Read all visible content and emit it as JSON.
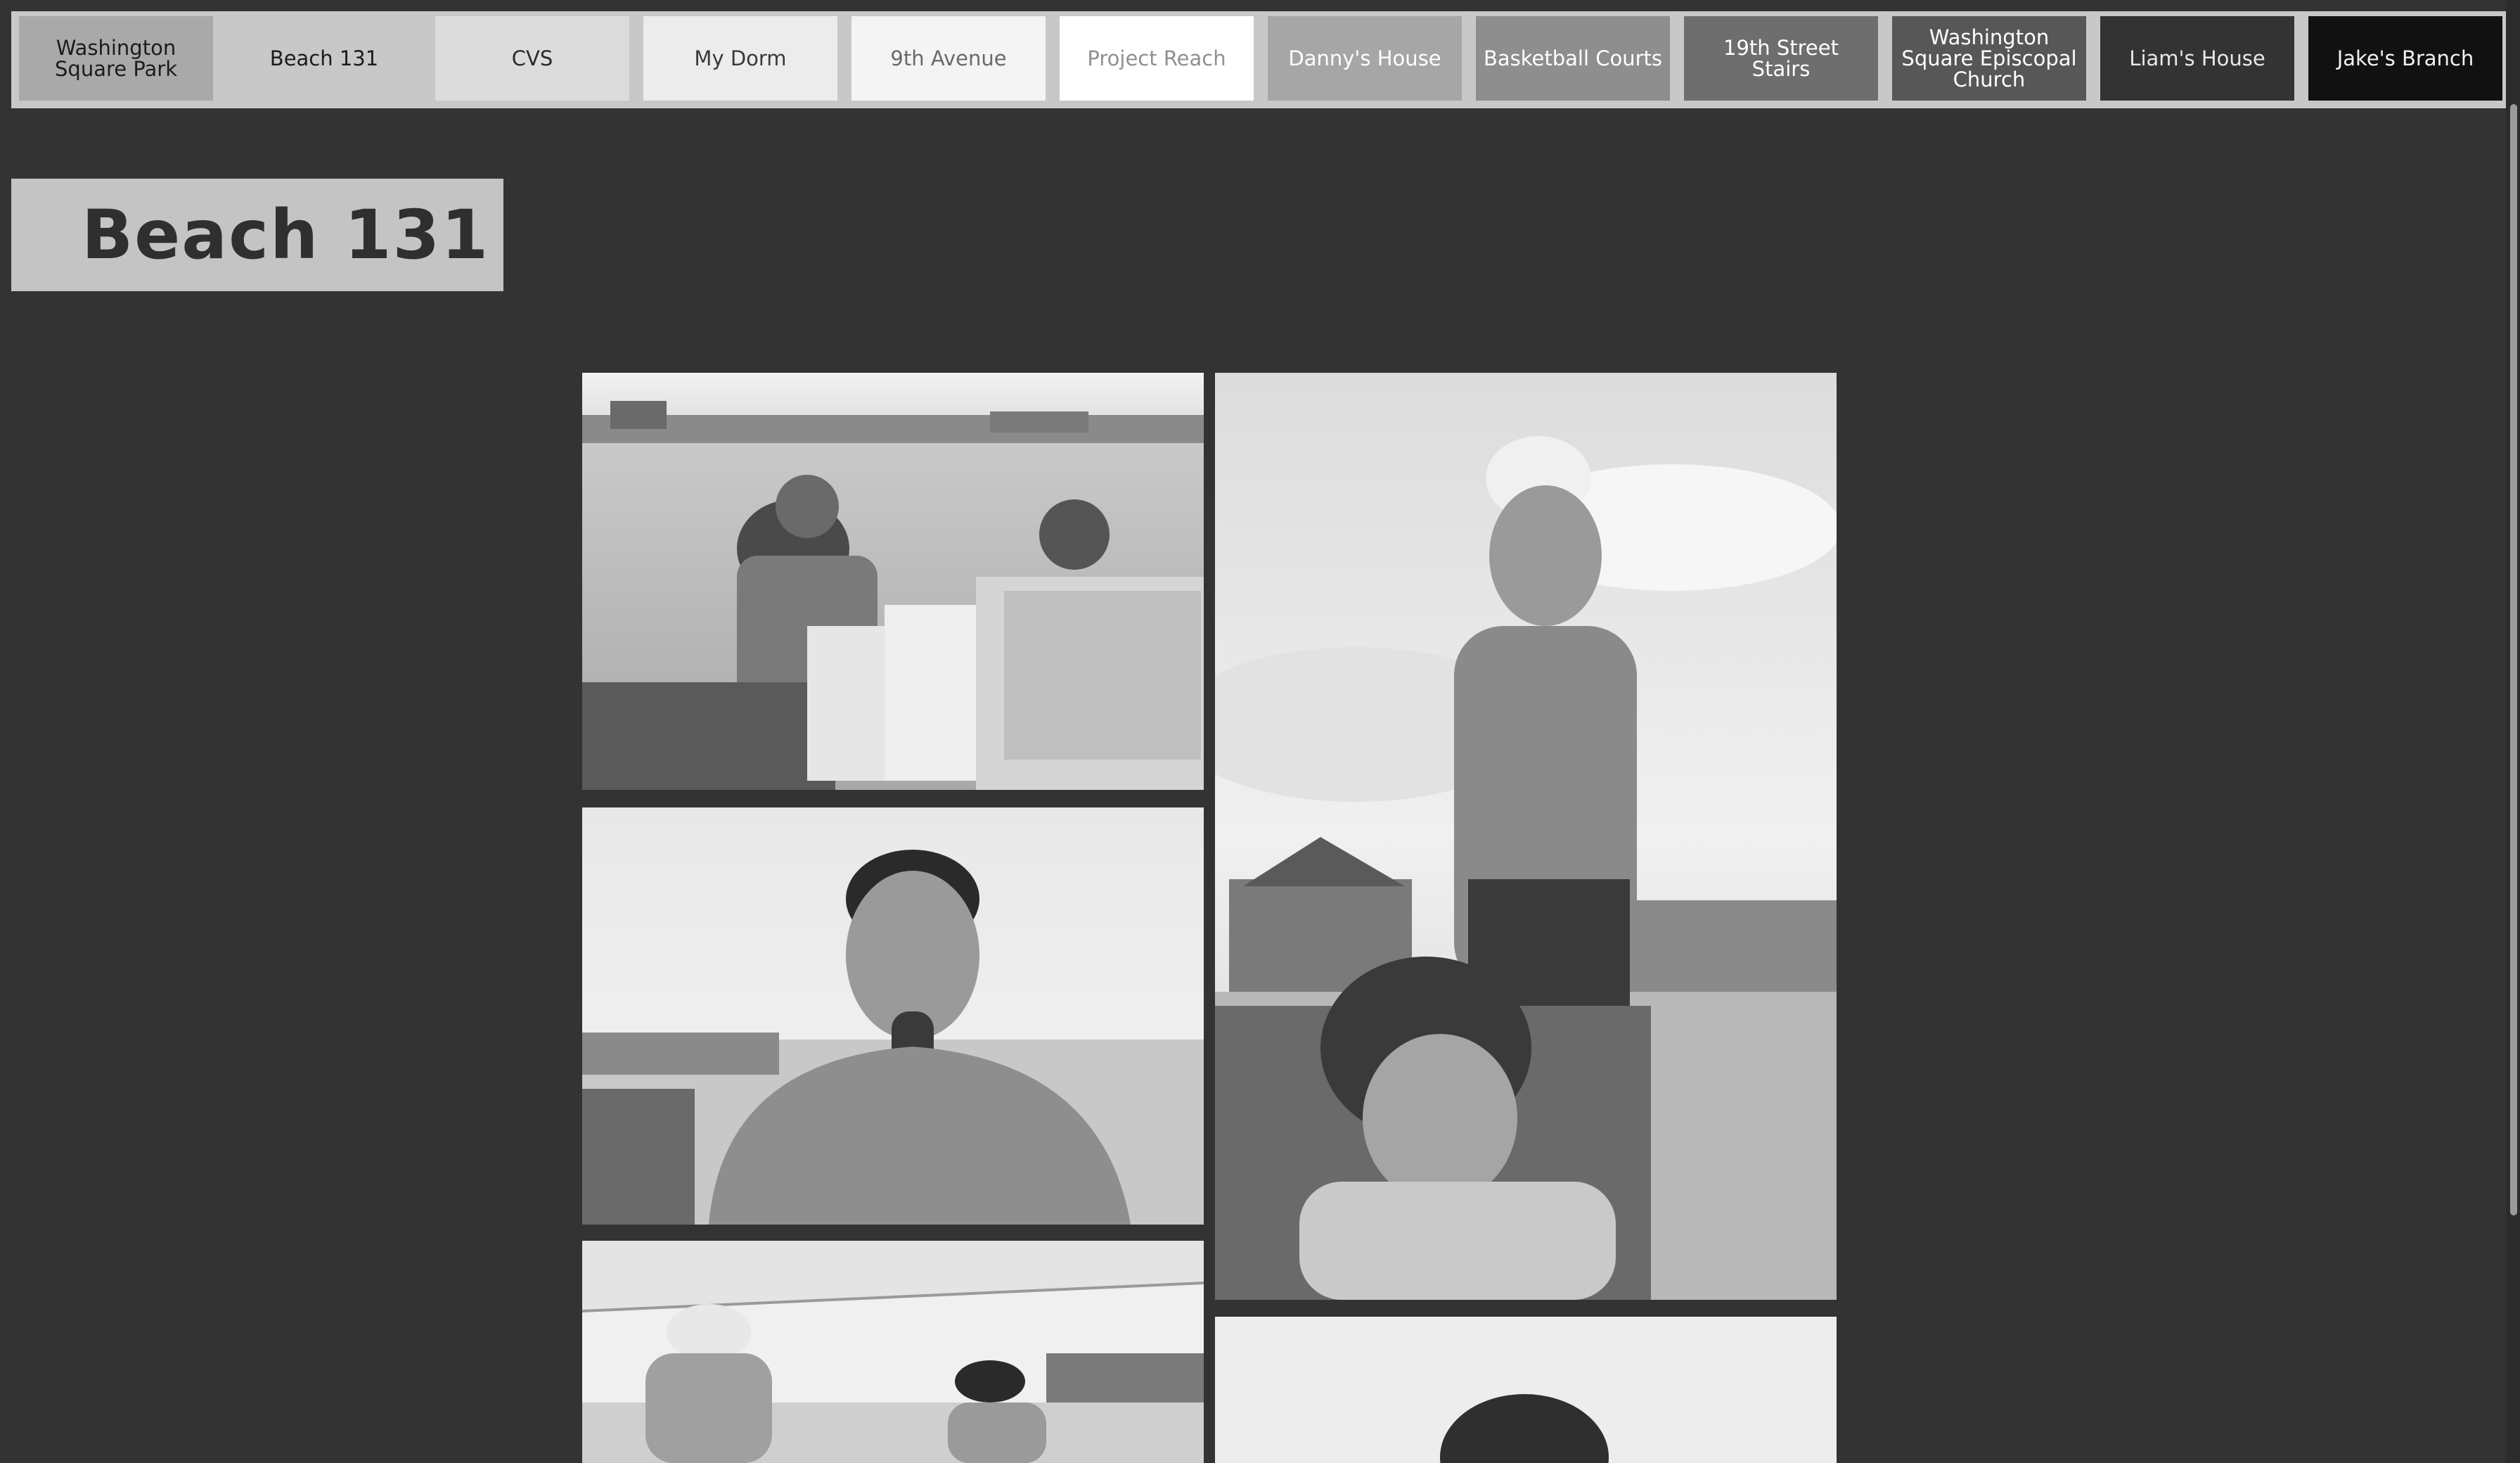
{
  "nav": {
    "items": [
      {
        "label": "Washington\nSquare Park",
        "bg": "#a9a9a9",
        "fg": "#1c1c1c"
      },
      {
        "label": "Beach 131",
        "bg": "#c8c8c8",
        "fg": "#1c1c1c"
      },
      {
        "label": "CVS",
        "bg": "#dcdcdc",
        "fg": "#2a2a2a"
      },
      {
        "label": "My Dorm",
        "bg": "#ececec",
        "fg": "#3a3a3a"
      },
      {
        "label": "9th Avenue",
        "bg": "#f4f4f4",
        "fg": "#6a6a6a"
      },
      {
        "label": "Project Reach",
        "bg": "#ffffff",
        "fg": "#909090"
      },
      {
        "label": "Danny's House",
        "bg": "#a6a6a6",
        "fg": "#ffffff"
      },
      {
        "label": "Basketball Courts",
        "bg": "#8e8e8e",
        "fg": "#ffffff"
      },
      {
        "label": "19th Street\nStairs",
        "bg": "#6e6e6e",
        "fg": "#ffffff"
      },
      {
        "label": "Washington\nSquare Episcopal\nChurch",
        "bg": "#575757",
        "fg": "#ffffff"
      },
      {
        "label": "Liam's House",
        "bg": "#333333",
        "fg": "#e8e8e8"
      },
      {
        "label": "Jake's Branch",
        "bg": "#111111",
        "fg": "#f2f2f2"
      }
    ]
  },
  "page": {
    "title": "Beach 131"
  },
  "photos": [
    {
      "name": "photo-couple-laughing-beach-chairs"
    },
    {
      "name": "photo-shirtless-man-drinking-bottle"
    },
    {
      "name": "photo-men-under-canopy"
    },
    {
      "name": "photo-young-man-cap-woman-towel"
    },
    {
      "name": "photo-person-bottom-right"
    }
  ]
}
